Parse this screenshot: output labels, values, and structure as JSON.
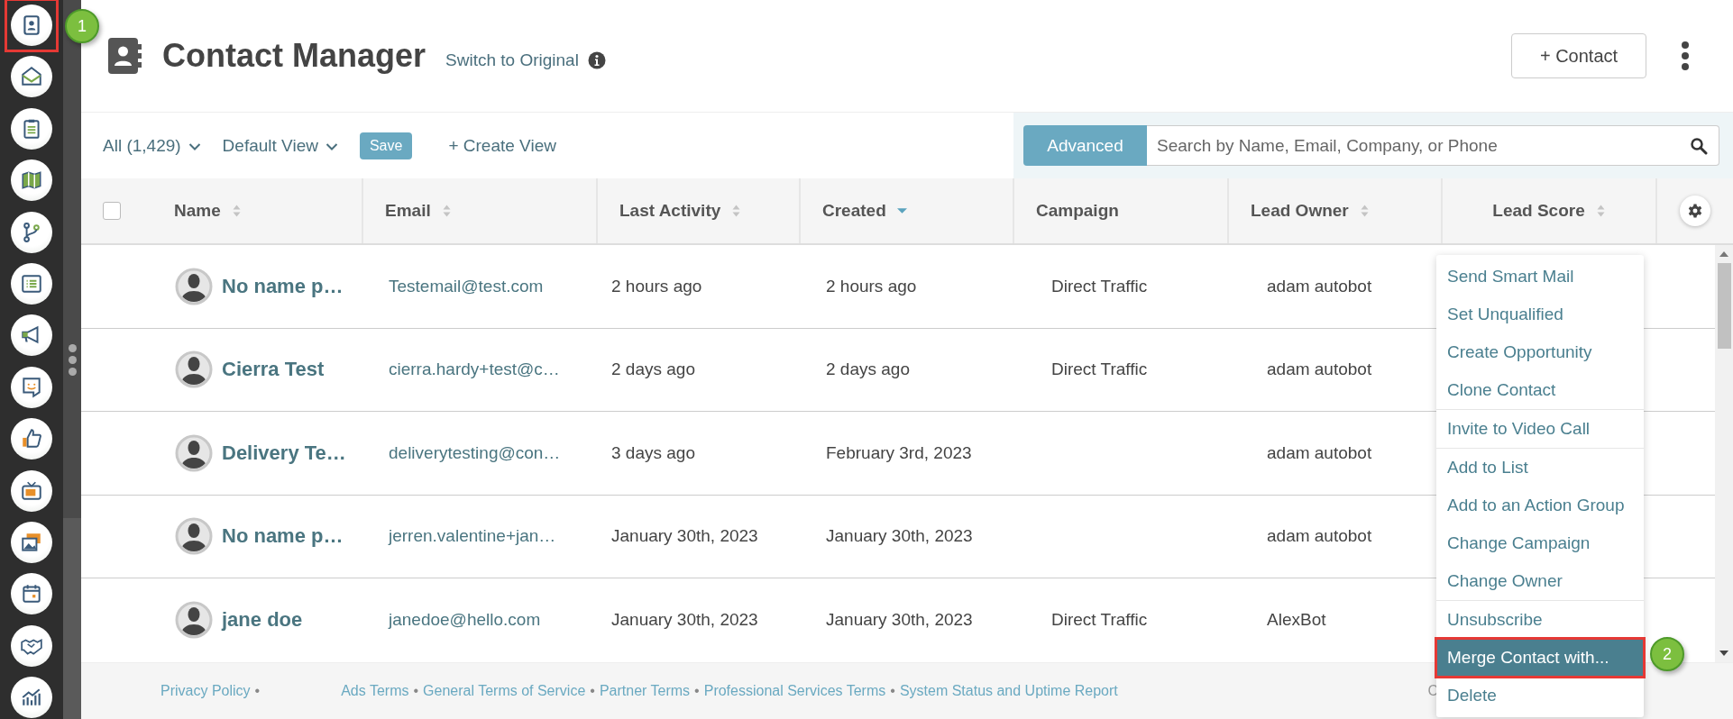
{
  "sidebar": {
    "items": [
      {
        "outlined": true
      },
      {
        "outlined": false
      },
      {
        "outlined": false
      },
      {
        "outlined": false
      },
      {
        "outlined": false
      },
      {
        "outlined": false
      },
      {
        "outlined": false
      },
      {
        "outlined": false
      },
      {
        "outlined": false
      },
      {
        "outlined": false
      },
      {
        "outlined": false
      },
      {
        "outlined": false
      },
      {
        "outlined": false
      },
      {
        "outlined": false
      }
    ]
  },
  "header": {
    "title": "Contact Manager",
    "switch_link": "Switch to Original",
    "add_button": "+ Contact"
  },
  "toolbar": {
    "filter": "All (1,429)",
    "view": "Default View",
    "save_button": "Save",
    "create_view": "+ Create View",
    "advanced_button": "Advanced",
    "search": {
      "placeholder": "Search by Name, Email, Company, or Phone"
    }
  },
  "table": {
    "select_all": {
      "checked": false
    },
    "columns": [
      {
        "label": "Name",
        "sortable": true,
        "sorted_descending": false
      },
      {
        "label": "Email",
        "sortable": true,
        "sorted_descending": false
      },
      {
        "label": "Last Activity",
        "sortable": true,
        "sorted_descending": false
      },
      {
        "label": "Created",
        "sorted_descending": true
      },
      {
        "label": "Campaign",
        "sortable": false,
        "sorted_descending": false
      },
      {
        "label": "Lead Owner",
        "sortable": true,
        "sorted_descending": false
      },
      {
        "label": "Lead Score",
        "sortable": true,
        "sorted_descending": false
      }
    ],
    "rows": [
      {
        "name": "No name p…",
        "email": "Testemail@test.com",
        "last_activity": "2 hours ago",
        "created": "2 hours ago",
        "campaign": "Direct Traffic",
        "owner": "adam autobot"
      },
      {
        "name": "Cierra Test",
        "email": "cierra.hardy+test@c…",
        "last_activity": "2 days ago",
        "created": "2 days ago",
        "campaign": "Direct Traffic",
        "owner": "adam autobot"
      },
      {
        "name": "Delivery Te…",
        "email": "deliverytesting@con…",
        "last_activity": "3 days ago",
        "created": "February 3rd, 2023",
        "owner": "adam autobot"
      },
      {
        "name": "No name p…",
        "email": "jerren.valentine+jan…",
        "last_activity": "January 30th, 2023",
        "created": "January 30th, 2023",
        "owner": "adam autobot"
      },
      {
        "name": "jane doe",
        "email": "janedoe@hello.com",
        "last_activity": "January 30th, 2023",
        "created": "January 30th, 2023",
        "campaign": "Direct Traffic",
        "owner": "AlexBot"
      }
    ]
  },
  "context_menu": {
    "groups": [
      {
        "items": [
          {
            "label": "Send Smart Mail",
            "selected": false,
            "outlined": false
          },
          {
            "label": "Set Unqualified",
            "selected": false,
            "outlined": false
          },
          {
            "label": "Create Opportunity",
            "selected": false,
            "outlined": false
          },
          {
            "label": "Clone Contact",
            "selected": false,
            "outlined": false
          }
        ]
      },
      {
        "items": [
          {
            "label": "Invite to Video Call",
            "selected": false,
            "outlined": false
          }
        ]
      },
      {
        "items": [
          {
            "label": "Add to List",
            "selected": false,
            "outlined": false
          },
          {
            "label": "Add to an Action Group",
            "selected": false,
            "outlined": false
          },
          {
            "label": "Change Campaign",
            "selected": false,
            "outlined": false
          },
          {
            "label": "Change Owner",
            "selected": false,
            "outlined": false
          }
        ]
      },
      {
        "items": [
          {
            "label": "Unsubscribe",
            "selected": false,
            "outlined": false
          },
          {
            "label": "Merge Contact with...",
            "selected": true,
            "outlined": true
          },
          {
            "label": "Delete",
            "selected": false,
            "outlined": false
          }
        ]
      }
    ]
  },
  "footer": {
    "left_links": [
      {
        "label": "Privacy Policy",
        "separator": "•"
      }
    ],
    "right_links": [
      {
        "label": "Ads Terms",
        "separator": "•"
      },
      {
        "label": "General Terms of Service",
        "separator": "•"
      },
      {
        "label": "Partner Terms",
        "separator": "•"
      },
      {
        "label": "Professional Services Terms",
        "separator": "•"
      },
      {
        "label": "System Status and Uptime Report"
      }
    ],
    "copyright": "C"
  },
  "callouts": [
    {
      "number": "1"
    },
    {
      "number": "2"
    }
  ]
}
